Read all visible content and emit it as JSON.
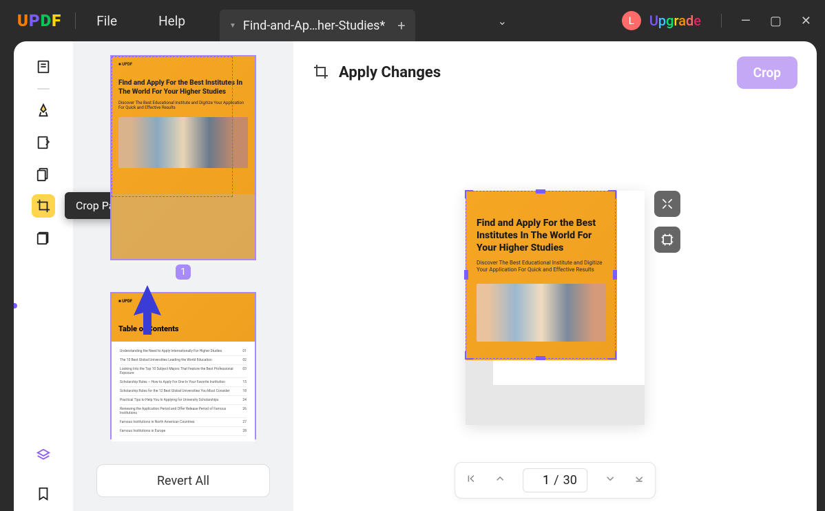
{
  "menus": {
    "file": "File",
    "help": "Help"
  },
  "tab": {
    "title": "Find-and-Ap…her-Studies*",
    "close": "+"
  },
  "upgrade": {
    "avatar_letter": "L",
    "text": "Upgrade"
  },
  "window_controls": {
    "minimize": "—",
    "maximize": "▢",
    "close": "✕"
  },
  "tools": {
    "reader": "reader",
    "highlight": "highlight",
    "edit": "edit",
    "ocr": "pages",
    "crop": "crop",
    "organize": "organize",
    "layers": "layers",
    "bookmark": "bookmark",
    "tooltip_crop": "Crop Pages"
  },
  "thumbnails": {
    "page1_number": "1",
    "doc_brand": "UPDF",
    "doc_title": "Find and Apply For the Best Institutes In The World For Your Higher Studies",
    "doc_subtitle": "Discover The Best Educational Institute and Digitize Your Application For Quick and Effective Results",
    "toc_title": "Table of Contents",
    "toc_items": [
      {
        "t": "Understanding the Need to Apply Internationally For Higher Studies",
        "p": "01"
      },
      {
        "t": "The 10 Best Global Universities Leading the World Education",
        "p": "02"
      },
      {
        "t": "Looking Into the Top 10 Subject Majors That Feature the Best Professional Exposure",
        "p": "03"
      },
      {
        "t": "Scholarship Rules – How to Apply For One In Your Favorite Institution",
        "p": "15"
      },
      {
        "t": "Scholarship Rules for the 12 Best Global Universities You Must Consider",
        "p": "18"
      },
      {
        "t": "Practical Tips to Help You In Applying for University Scholarships",
        "p": "24"
      },
      {
        "t": "Reviewing the Application Period and Offer Release Period of Famous Institutions",
        "p": "26"
      },
      {
        "t": "Famous Institutions in North American Countries",
        "p": "27"
      },
      {
        "t": "Famous Institutions in Europe",
        "p": "28"
      }
    ],
    "revert_button": "Revert All"
  },
  "main": {
    "apply_title": "Apply Changes",
    "crop_button": "Crop",
    "doc_title": "Find and Apply For the Best Institutes In The World For Your Higher Studies",
    "doc_subtitle": "Discover The Best Educational Institute and Digitize Your Application For Quick and Effective Results"
  },
  "pager": {
    "current": "1",
    "separator": "/",
    "total": "30"
  }
}
